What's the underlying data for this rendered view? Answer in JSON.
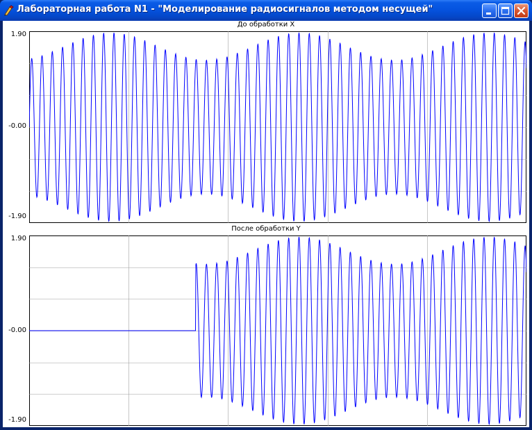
{
  "window": {
    "title": "Лабораторная работа N1 - \"Моделирование радиосигналов методом несущей\"",
    "title_color": "#ffffff",
    "titlebar_color": "#0553df",
    "icons": [
      "app-icon",
      "minimize-icon",
      "maximize-icon",
      "close-icon"
    ]
  },
  "plots": [
    {
      "title": "До обработки X",
      "y_max_label": "1.90",
      "y_mid_label": "-0.00",
      "y_min_label": "-1.90",
      "line_color": "#0000ff",
      "grid_color": "#a0a0a0"
    },
    {
      "title": "После обработки Y",
      "y_max_label": "1.90",
      "y_mid_label": "-0.00",
      "y_min_label": "-1.90",
      "line_color": "#0000ff",
      "grid_color": "#a0a0a0"
    }
  ],
  "chart_data": [
    {
      "type": "line",
      "title": "До обработки X",
      "ylim": [
        -1.9,
        1.9
      ],
      "grid": true,
      "series": [
        {
          "values": "amplitude-modulated carrier: ~16 carrier periods per modulation period, envelope 1.35 .. 1.9, ~2.6 modulation periods visible"
        }
      ]
    },
    {
      "type": "line",
      "title": "После обработки Y",
      "ylim": [
        -1.9,
        1.9
      ],
      "grid": true,
      "series": [
        {
          "values": "zero for first ~32% of the record, then the same amplitude-modulated carrier"
        }
      ]
    }
  ]
}
